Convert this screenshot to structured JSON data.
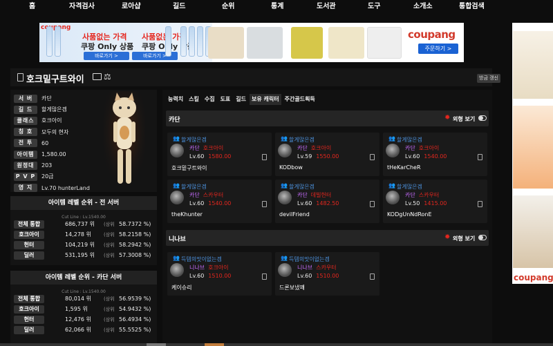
{
  "nav": [
    "홈",
    "자격검사",
    "로아샵",
    "길드",
    "순위",
    "통계",
    "도서관",
    "도구",
    "소개소",
    "통합검색"
  ],
  "ad": {
    "logo": "coupang",
    "line1": "사품없는 가격",
    "line1b": "사품없는 가격",
    "line2": "쿠팡 Only 상품",
    "line2b": "쿠팡 Only 상품",
    "btn": "바로가기 >",
    "brand": "coupang",
    "cta": "주문하기 >"
  },
  "right_ad": {
    "brand": "coupang"
  },
  "character": {
    "name": "호크밑구트와이",
    "refresh": "방금 갱신",
    "profile": [
      {
        "label": "서 버",
        "value": "카단"
      },
      {
        "label": "길 드",
        "value": "할게많은겜"
      },
      {
        "label": "클래스",
        "value": "호크아이"
      },
      {
        "label": "칭 호",
        "value": "모두의 현자"
      },
      {
        "label": "전 투",
        "value": "60"
      },
      {
        "label": "아이템",
        "value": "1,580.00"
      },
      {
        "label": "원정대",
        "value": "203"
      },
      {
        "label": "P V P",
        "value": "20급"
      },
      {
        "label": "영 지",
        "value": "Lv.70 hunterLand"
      }
    ]
  },
  "rank_all": {
    "title": "아이템 레벨 순위 - 전 서버",
    "cutline": "Cut Line : Lv.1540.00",
    "rows": [
      {
        "label": "전체 통합",
        "rank": "686,737 위",
        "mid": "(상위",
        "pct": "58.7372 %)"
      },
      {
        "label": "호크아이",
        "rank": "14,278 위",
        "mid": "(상위",
        "pct": "58.2158 %)"
      },
      {
        "label": "헌터",
        "rank": "104,219 위",
        "mid": "(상위",
        "pct": "58.2942 %)"
      },
      {
        "label": "딜러",
        "rank": "531,195 위",
        "mid": "(상위",
        "pct": "57.3008 %)"
      }
    ]
  },
  "rank_server": {
    "title": "아이템 레벨 순위 - 카단 서버",
    "cutline": "Cut Line : Lv.1540.00",
    "rows": [
      {
        "label": "전체 통합",
        "rank": "80,014 위",
        "mid": "(상위",
        "pct": "56.9539 %)"
      },
      {
        "label": "호크아이",
        "rank": "1,595 위",
        "mid": "(상위",
        "pct": "54.9432 %)"
      },
      {
        "label": "헌터",
        "rank": "12,476 위",
        "mid": "(상위",
        "pct": "56.4934 %)"
      },
      {
        "label": "딜러",
        "rank": "62,066 위",
        "mid": "(상위",
        "pct": "55.5525 %)"
      }
    ]
  },
  "tabs": [
    "능력치",
    "스킬",
    "수집",
    "도표",
    "길드",
    "보유 캐릭터",
    "주간골드획득"
  ],
  "active_tab": 5,
  "toggle_label": "외형 보기",
  "groups": [
    {
      "server": "카단",
      "chars": [
        {
          "guild": "할게많은겜",
          "srv": "카단",
          "cls": "호크아이",
          "lv": "Lv.60",
          "ilv": "1580.00",
          "name": "호크밑구트와이"
        },
        {
          "guild": "할게많은겜",
          "srv": "카단",
          "cls": "호크아이",
          "lv": "Lv.59",
          "ilv": "1550.00",
          "name": "KODbow"
        },
        {
          "guild": "할게많은겜",
          "srv": "카단",
          "cls": "호크아이",
          "lv": "Lv.60",
          "ilv": "1540.00",
          "name": "tHeKarCheR"
        },
        {
          "guild": "할게많은겜",
          "srv": "카단",
          "cls": "스카우터",
          "lv": "Lv.60",
          "ilv": "1540.00",
          "name": "theKhunter"
        },
        {
          "guild": "할게많은겜",
          "srv": "카단",
          "cls": "데빌헌터",
          "lv": "Lv.60",
          "ilv": "1482.50",
          "name": "devilFriend"
        },
        {
          "guild": "할게많은겜",
          "srv": "카단",
          "cls": "스카우터",
          "lv": "Lv.50",
          "ilv": "1415.00",
          "name": "KODgUnNdRonE"
        }
      ]
    },
    {
      "server": "니나브",
      "chars": [
        {
          "guild": "득템의맛이없는겜",
          "srv": "니나브",
          "cls": "호크아이",
          "lv": "Lv.60",
          "ilv": "1510.00",
          "name": "케이슈리"
        },
        {
          "guild": "득템의맛이없는겜",
          "srv": "니나브",
          "cls": "스카우터",
          "lv": "Lv.60",
          "ilv": "1510.00",
          "name": "드론보냈꽤"
        }
      ]
    }
  ]
}
